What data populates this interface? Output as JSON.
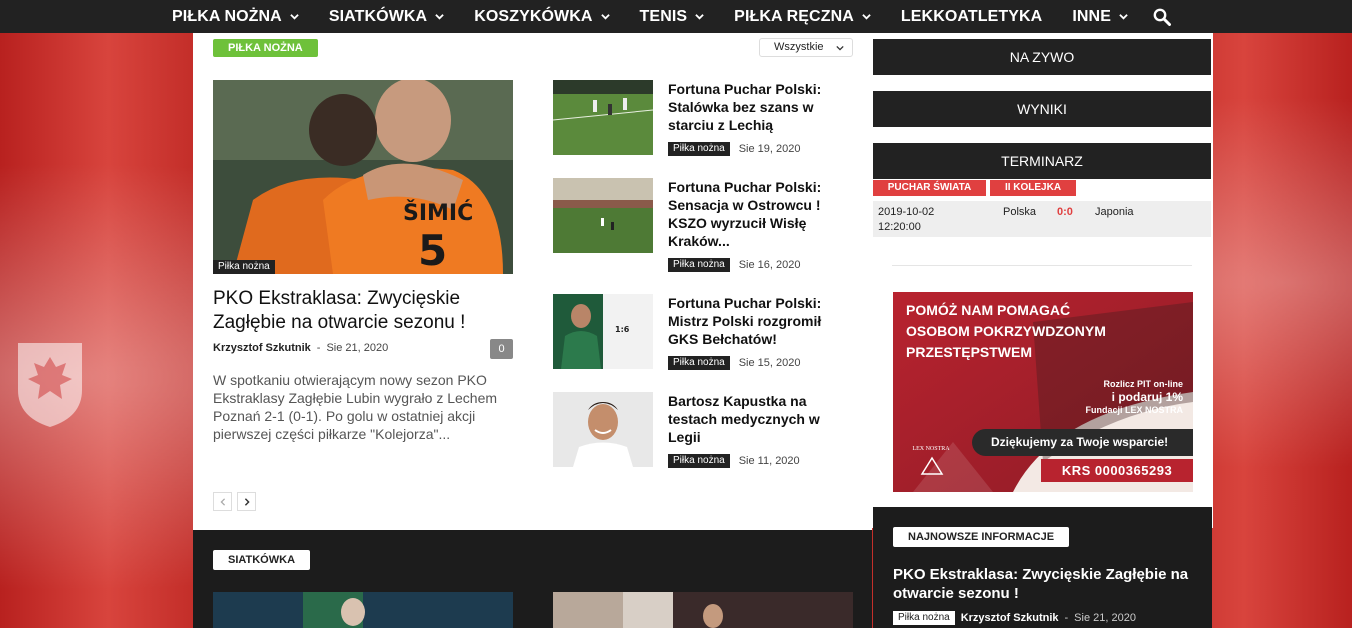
{
  "nav": {
    "items": [
      {
        "label": "PIŁKA NOŻNA",
        "dropdown": true
      },
      {
        "label": "SIATKÓWKA",
        "dropdown": true
      },
      {
        "label": "KOSZYKÓWKA",
        "dropdown": true
      },
      {
        "label": "TENIS",
        "dropdown": true
      },
      {
        "label": "PIŁKA RĘCZNA",
        "dropdown": true
      },
      {
        "label": "LEKKOATLETYKA",
        "dropdown": false
      },
      {
        "label": "INNE",
        "dropdown": true
      }
    ],
    "search_icon": "search-icon"
  },
  "section": {
    "tag": "PIŁKA NOŻNA",
    "filter_label": "Wszystkie"
  },
  "lead": {
    "category": "Piłka nożna",
    "title": "PKO Ekstraklasa: Zwycięskie Zagłębie na otwarcie sezonu !",
    "author": "Krzysztof Szkutnik",
    "separator": "-",
    "date": "Sie 21, 2020",
    "comments": "0",
    "excerpt": "W spotkaniu otwierającym nowy sezon PKO Ekstraklasy Zagłębie Lubin wygrało z Lechem Poznań 2-1 (0-1). Po golu w ostatniej akcji pierwszej części piłkarze \"Kolejorza\"..."
  },
  "news": [
    {
      "title": "Fortuna Puchar Polski: Stalówka bez szans w starciu z Lechią",
      "category": "Piłka nożna",
      "date": "Sie 19, 2020"
    },
    {
      "title": "Fortuna Puchar Polski: Sensacja w Ostrowcu ! KSZO wyrzucił Wisłę Kraków...",
      "category": "Piłka nożna",
      "date": "Sie 16, 2020"
    },
    {
      "title": "Fortuna Puchar Polski: Mistrz Polski rozgromił GKS Bełchatów!",
      "category": "Piłka nożna",
      "date": "Sie 15, 2020"
    },
    {
      "title": "Bartosz Kapustka na testach medycznych w Legii",
      "category": "Piłka nożna",
      "date": "Sie 11, 2020"
    }
  ],
  "sidebar": {
    "live": "NA ZYWO",
    "results": "WYNIKI",
    "schedule": "TERMINARZ",
    "tabs": [
      "PUCHAR ŚWIATA",
      "II KOLEJKA"
    ],
    "match": {
      "date": "2019-10-02",
      "time": "12:20:00",
      "home": "Polska",
      "score": "0:0",
      "away": "Japonia"
    },
    "ad": {
      "headline": [
        "POMÓŻ NAM POMAGAĆ",
        "OSOBOM POKRZYWDZONYM",
        "PRZESTĘPSTWEM"
      ],
      "pit_line1": "Rozlicz PIT on-line",
      "pit_line2": "i podaruj 1%",
      "pit_line3": "Fundacji LEX NOSTRA",
      "thanks": "Dziękujemy za Twoje wsparcie!",
      "krs": "KRS 0000365293",
      "logo": "LEX NOSTRA"
    },
    "latest_tag": "NAJNOWSZE INFORMACJE",
    "latest": {
      "title": "PKO Ekstraklasa: Zwycięskie Zagłębie na otwarcie sezonu !",
      "category": "Piłka nożna",
      "author": "Krzysztof Szkutnik",
      "date": "Sie 21, 2020"
    }
  },
  "volleyball": {
    "tag": "SIATKÓWKA"
  },
  "colors": {
    "nav_bg": "#222222",
    "green_tag": "#6ec13a",
    "red_tab": "#e04040",
    "score_red": "#e04040",
    "dark_section": "#1c1c1c",
    "ad_red": "#b8232f"
  }
}
